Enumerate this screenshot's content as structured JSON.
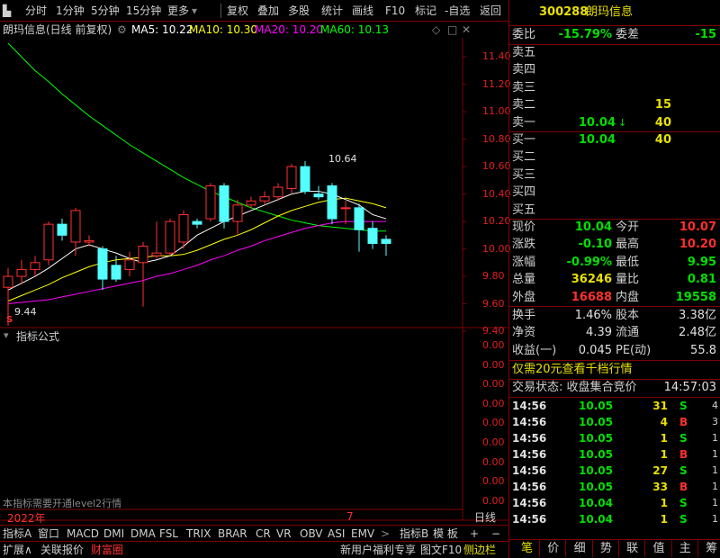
{
  "toolbar": {
    "items": [
      "分时",
      "1分钟",
      "5分钟",
      "15分钟",
      "更多",
      "复权",
      "叠加",
      "多股",
      "统计",
      "画线",
      "F10",
      "标记",
      "-自选",
      "返回"
    ]
  },
  "chart": {
    "title": "朗玛信息(日线 前复权)",
    "ma5": "MA5: 10.22",
    "ma10": "MA10: 10.30",
    "ma20": "MA20: 10.20",
    "ma60": "MA60: 10.13",
    "y_ticks": [
      "11.40",
      "11.20",
      "11.00",
      "10.80",
      "10.60",
      "10.40",
      "10.20",
      "10.00",
      "9.80",
      "9.60",
      "9.40"
    ],
    "high_label": "10.64",
    "low_label": "9.44",
    "s_marker": "S",
    "x_year": "2022年",
    "x_month": "7",
    "indicator_title": "指标公式",
    "indicator_ticks": [
      "0.00",
      "0.00",
      "0.00",
      "0.00",
      "0.00",
      "0.00",
      "0.00",
      "0.00",
      "0.00"
    ],
    "indicator_note": "本指标需要开通level2行情",
    "period_label": "日线"
  },
  "chart_data": {
    "type": "candlestick",
    "ylim": [
      9.4,
      11.5
    ],
    "candles": [
      {
        "o": 9.72,
        "h": 9.86,
        "l": 9.44,
        "c": 9.8
      },
      {
        "o": 9.8,
        "h": 9.92,
        "l": 9.74,
        "c": 9.85
      },
      {
        "o": 9.85,
        "h": 9.95,
        "l": 9.8,
        "c": 9.9
      },
      {
        "o": 9.92,
        "h": 10.2,
        "l": 9.88,
        "c": 10.18
      },
      {
        "o": 10.18,
        "h": 10.22,
        "l": 10.06,
        "c": 10.1
      },
      {
        "o": 10.05,
        "h": 10.3,
        "l": 9.95,
        "c": 10.28
      },
      {
        "o": 10.05,
        "h": 10.1,
        "l": 10.02,
        "c": 10.06
      },
      {
        "o": 10.0,
        "h": 10.02,
        "l": 9.7,
        "c": 9.78
      },
      {
        "o": 9.88,
        "h": 9.95,
        "l": 9.76,
        "c": 9.78
      },
      {
        "o": 9.85,
        "h": 9.98,
        "l": 9.8,
        "c": 9.92
      },
      {
        "o": 9.9,
        "h": 10.05,
        "l": 9.58,
        "c": 10.02
      },
      {
        "o": 9.95,
        "h": 10.2,
        "l": 9.93,
        "c": 9.97
      },
      {
        "o": 9.97,
        "h": 10.22,
        "l": 9.95,
        "c": 10.2
      },
      {
        "o": 10.05,
        "h": 10.28,
        "l": 10.0,
        "c": 10.25
      },
      {
        "o": 10.2,
        "h": 10.22,
        "l": 10.15,
        "c": 10.18
      },
      {
        "o": 10.22,
        "h": 10.48,
        "l": 10.2,
        "c": 10.46
      },
      {
        "o": 10.46,
        "h": 10.48,
        "l": 10.15,
        "c": 10.2
      },
      {
        "o": 10.2,
        "h": 10.36,
        "l": 10.1,
        "c": 10.32
      },
      {
        "o": 10.32,
        "h": 10.38,
        "l": 10.3,
        "c": 10.35
      },
      {
        "o": 10.35,
        "h": 10.42,
        "l": 10.32,
        "c": 10.38
      },
      {
        "o": 10.38,
        "h": 10.48,
        "l": 10.35,
        "c": 10.45
      },
      {
        "o": 10.44,
        "h": 10.62,
        "l": 10.4,
        "c": 10.6
      },
      {
        "o": 10.6,
        "h": 10.64,
        "l": 10.4,
        "c": 10.42
      },
      {
        "o": 10.4,
        "h": 10.46,
        "l": 10.36,
        "c": 10.38
      },
      {
        "o": 10.46,
        "h": 10.48,
        "l": 10.18,
        "c": 10.22
      },
      {
        "o": 10.3,
        "h": 10.35,
        "l": 10.18,
        "c": 10.3
      },
      {
        "o": 10.3,
        "h": 10.33,
        "l": 9.98,
        "c": 10.14
      },
      {
        "o": 10.15,
        "h": 10.2,
        "l": 10.0,
        "c": 10.04
      },
      {
        "o": 10.07,
        "h": 10.1,
        "l": 9.95,
        "c": 10.04
      }
    ],
    "ma5": [
      9.7,
      9.75,
      9.8,
      9.86,
      9.93,
      10.0,
      10.03,
      10.0,
      9.97,
      9.93,
      9.9,
      9.92,
      9.95,
      10.02,
      10.1,
      10.15,
      10.2,
      10.24,
      10.28,
      10.32,
      10.36,
      10.4,
      10.42,
      10.42,
      10.4,
      10.36,
      10.32,
      10.25,
      10.22
    ],
    "ma10": [
      9.62,
      9.66,
      9.7,
      9.74,
      9.79,
      9.83,
      9.87,
      9.9,
      9.92,
      9.93,
      9.94,
      9.95,
      9.95,
      9.96,
      9.99,
      10.03,
      10.07,
      10.1,
      10.14,
      10.19,
      10.24,
      10.28,
      10.31,
      10.34,
      10.36,
      10.37,
      10.35,
      10.33,
      10.3
    ],
    "ma20": [
      9.6,
      9.61,
      9.62,
      9.63,
      9.65,
      9.67,
      9.69,
      9.71,
      9.73,
      9.75,
      9.77,
      9.8,
      9.82,
      9.85,
      9.88,
      9.92,
      9.95,
      9.99,
      10.02,
      10.06,
      10.09,
      10.12,
      10.15,
      10.17,
      10.19,
      10.2,
      10.2,
      10.2,
      10.2
    ],
    "ma60": [
      11.5,
      11.4,
      11.3,
      11.22,
      11.13,
      11.05,
      10.97,
      10.9,
      10.83,
      10.76,
      10.7,
      10.64,
      10.58,
      10.52,
      10.47,
      10.42,
      10.38,
      10.34,
      10.3,
      10.27,
      10.24,
      10.21,
      10.19,
      10.17,
      10.16,
      10.15,
      10.14,
      10.13,
      10.13
    ]
  },
  "quote": {
    "code": "300288",
    "name": "朗玛信息",
    "webi_label": "委比",
    "webi_value": "-15.79%",
    "weicha_label": "委差",
    "weicha_value": "-15",
    "sell_labels": [
      "卖五",
      "卖四",
      "卖三",
      "卖二",
      "卖一"
    ],
    "sell_prices": [
      "",
      "",
      "",
      "",
      "10.04"
    ],
    "sell_vols": [
      "",
      "",
      "",
      "15",
      "40"
    ],
    "buy_labels": [
      "买一",
      "买二",
      "买三",
      "买四",
      "买五"
    ],
    "buy_prices": [
      "10.04",
      "",
      "",
      "",
      ""
    ],
    "buy_vols": [
      "40",
      "",
      "",
      "",
      ""
    ],
    "stats": [
      {
        "l1": "现价",
        "v1": "10.04",
        "l2": "今开",
        "v2": "10.07"
      },
      {
        "l1": "涨跌",
        "v1": "-0.10",
        "l2": "最高",
        "v2": "10.20"
      },
      {
        "l1": "涨幅",
        "v1": "-0.99%",
        "l2": "最低",
        "v2": "9.95"
      },
      {
        "l1": "总量",
        "v1": "36246",
        "l2": "量比",
        "v2": "0.81"
      },
      {
        "l1": "外盘",
        "v1": "16688",
        "l2": "内盘",
        "v2": "19558"
      }
    ],
    "stats2": [
      {
        "l1": "换手",
        "v1": "1.46%",
        "l2": "股本",
        "v2": "3.38亿"
      },
      {
        "l1": "净资",
        "v1": "4.39",
        "l2": "流通",
        "v2": "2.48亿"
      },
      {
        "l1": "收益(一)",
        "v1": "0.045",
        "l2": "PE(动)",
        "v2": "55.8"
      }
    ],
    "promo": "仅需20元查看千档行情",
    "trade_status_label": "交易状态: 收盘集合竞价",
    "trade_status_time": "14:57:03",
    "ticks": [
      {
        "t": "14:56",
        "p": "10.05",
        "v": "31",
        "s": "S",
        "n": "4"
      },
      {
        "t": "14:56",
        "p": "10.05",
        "v": "4",
        "s": "B",
        "n": "3"
      },
      {
        "t": "14:56",
        "p": "10.05",
        "v": "1",
        "s": "S",
        "n": "1"
      },
      {
        "t": "14:56",
        "p": "10.05",
        "v": "1",
        "s": "B",
        "n": "1"
      },
      {
        "t": "14:56",
        "p": "10.05",
        "v": "27",
        "s": "S",
        "n": "1"
      },
      {
        "t": "14:56",
        "p": "10.05",
        "v": "33",
        "s": "B",
        "n": "1"
      },
      {
        "t": "14:56",
        "p": "10.04",
        "v": "1",
        "s": "S",
        "n": "1"
      },
      {
        "t": "14:56",
        "p": "10.04",
        "v": "1",
        "s": "S",
        "n": "1"
      }
    ],
    "bottom_tabs": [
      "笔",
      "价",
      "细",
      "势",
      "联",
      "值",
      "主",
      "筹"
    ]
  },
  "bottom_bar1": [
    "指标A",
    "窗口",
    "MACD",
    "DMI",
    "DMA",
    "FSL",
    "TRIX",
    "BRAR",
    "CR",
    "VR",
    "OBV",
    "ASI",
    "EMV",
    "指标B",
    "模 板"
  ],
  "bottom_bar2": [
    "扩展∧",
    "关联报价",
    "财富圈",
    "新用户福利专享",
    "图文F10",
    "侧边栏"
  ],
  "colors": {
    "up": "#ff3030",
    "down": "#00e000",
    "candle_down_fill": "#54ffff",
    "ma5": "#ffffff",
    "ma10": "#ffff00",
    "ma20": "#ff00ff",
    "ma60": "#00ff00",
    "grid": "#800000"
  }
}
